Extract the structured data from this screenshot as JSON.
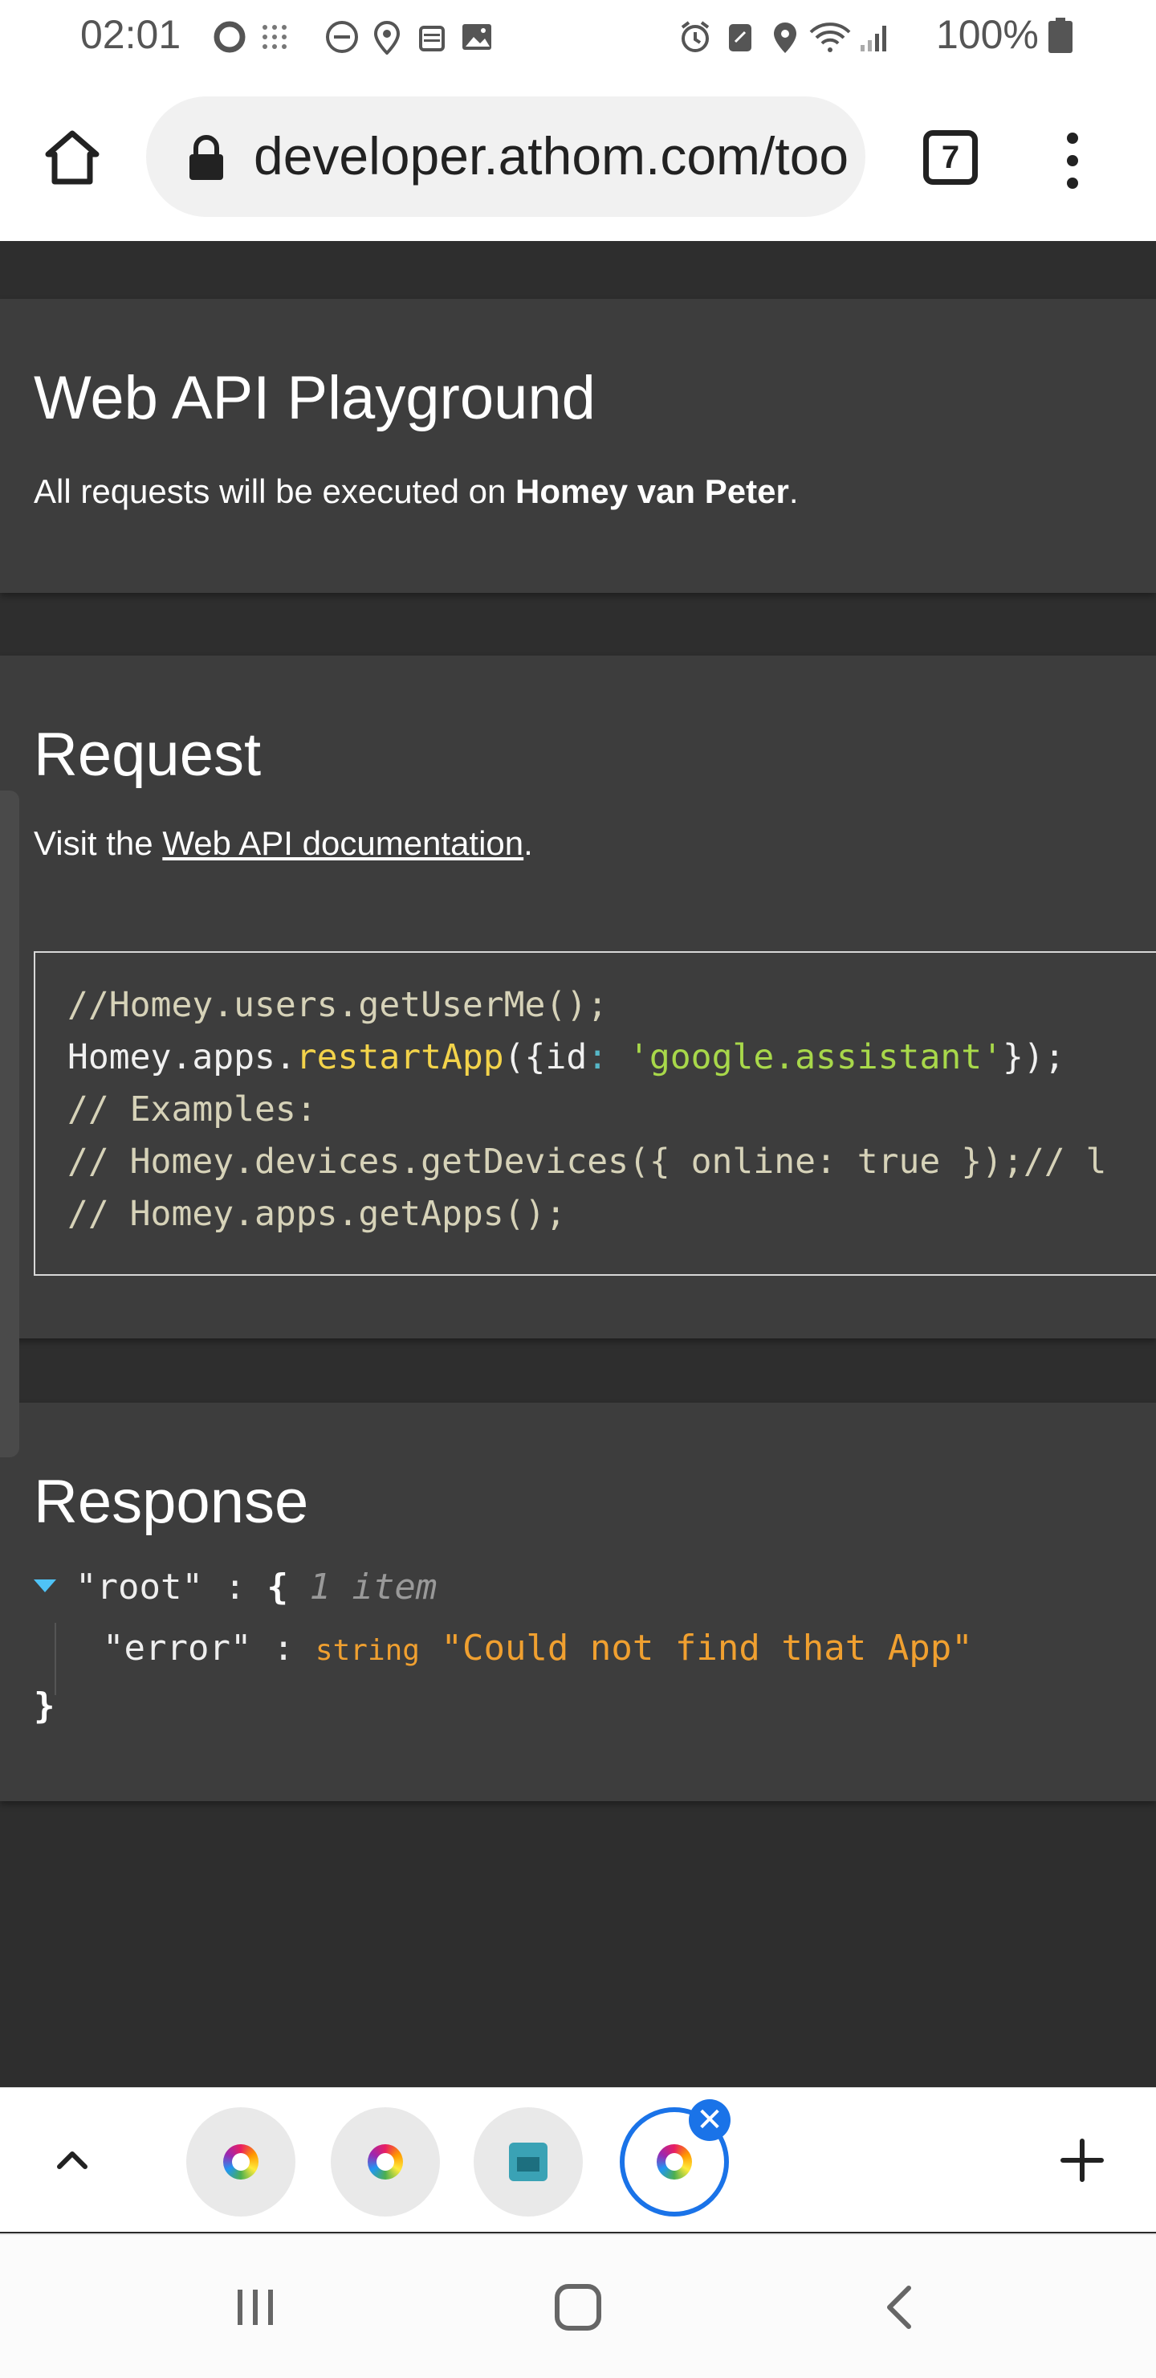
{
  "status_bar": {
    "time": "02:01",
    "battery": "100%",
    "left_icons": [
      "ring-icon",
      "grid-dots-icon",
      "dnd-icon",
      "location-pin-icon",
      "alarm-clock-icon",
      "image-icon"
    ],
    "right_icons": [
      "alarm-icon",
      "nfc-icon",
      "location-icon",
      "wifi-icon",
      "signal-icon"
    ]
  },
  "browser": {
    "url": "developer.athom.com/too",
    "tab_count": "7"
  },
  "header_card": {
    "title": "Web API Playground",
    "desc_prefix": "All requests will be executed on ",
    "device": "Homey van Peter",
    "desc_suffix": "."
  },
  "request_card": {
    "title": "Request",
    "visit_prefix": "Visit the ",
    "doc_link": "Web API documentation",
    "visit_suffix": ".",
    "code": {
      "line1": "//Homey.users.getUserMe();",
      "line2_obj": "Homey.apps.",
      "line2_fn": "restartApp",
      "line2_open": "({id",
      "line2_colon": ": ",
      "line2_str": "'google.assistant'",
      "line2_close": "});",
      "line3": "// Examples:",
      "line4": "// Homey.devices.getDevices({ online: true });// l",
      "line5": "// Homey.apps.getApps();"
    }
  },
  "response_card": {
    "title": "Response",
    "root_key": "\"root\"",
    "sep": " : ",
    "open_brace": "{",
    "item_count": "1 item",
    "error_key": "\"error\"",
    "error_type": "string",
    "error_value": "\"Could not find that App\"",
    "close_brace": "}"
  },
  "tab_strip": {
    "tabs": [
      "homey-app-icon",
      "homey-app-icon",
      "home-icon",
      "homey-app-icon"
    ],
    "active_index": 3,
    "close_glyph": "✕"
  },
  "colors": {
    "accent": "#1a73e8",
    "page_bg": "#2e2e2e",
    "card_bg": "#3d3d3d",
    "code_fn": "#f3d34a",
    "code_str": "#a8d84a",
    "value_orange": "#f0a030"
  }
}
